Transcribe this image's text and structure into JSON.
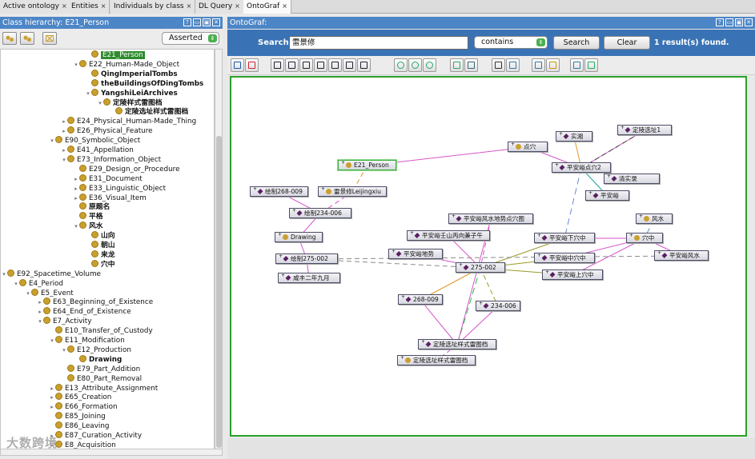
{
  "tabs": [
    {
      "label": "Active ontology",
      "close": "×",
      "active": false
    },
    {
      "label": "Entities",
      "close": "×",
      "active": false
    },
    {
      "label": "Individuals by class",
      "close": "×",
      "active": false
    },
    {
      "label": "DL Query",
      "close": "×",
      "active": false
    },
    {
      "label": "OntoGraf",
      "close": "×",
      "active": true
    }
  ],
  "left": {
    "title": "Class hierarchy: E21_Person",
    "header_buttons": [
      "?",
      "▭",
      "▣",
      "✕"
    ],
    "asserted": "Asserted",
    "tree": [
      {
        "label": "E21_Person",
        "indent": 140,
        "twisty": "",
        "bold": false,
        "sel": true
      },
      {
        "label": "E22_Human-Made_Object",
        "indent": 125,
        "twisty": "▾",
        "bold": false
      },
      {
        "label": "QingImperialTombs",
        "indent": 140,
        "twisty": "",
        "bold": true
      },
      {
        "label": "theBuildingsOfDingTombs",
        "indent": 140,
        "twisty": "",
        "bold": true
      },
      {
        "label": "YangshiLeiArchives",
        "indent": 140,
        "twisty": "▾",
        "bold": true
      },
      {
        "label": "定陵样式雷图档",
        "indent": 155,
        "twisty": "▾",
        "bold": true
      },
      {
        "label": "定陵选址样式雷图档",
        "indent": 170,
        "twisty": "",
        "bold": true
      },
      {
        "label": "E24_Physical_Human-Made_Thing",
        "indent": 110,
        "twisty": "▸",
        "bold": false
      },
      {
        "label": "E26_Physical_Feature",
        "indent": 110,
        "twisty": "▸",
        "bold": false
      },
      {
        "label": "E90_Symbolic_Object",
        "indent": 95,
        "twisty": "▾",
        "bold": false
      },
      {
        "label": "E41_Appellation",
        "indent": 110,
        "twisty": "▸",
        "bold": false
      },
      {
        "label": "E73_Information_Object",
        "indent": 110,
        "twisty": "▾",
        "bold": false
      },
      {
        "label": "E29_Design_or_Procedure",
        "indent": 125,
        "twisty": "",
        "bold": false
      },
      {
        "label": "E31_Document",
        "indent": 125,
        "twisty": "▸",
        "bold": false
      },
      {
        "label": "E33_Linguistic_Object",
        "indent": 125,
        "twisty": "▸",
        "bold": false
      },
      {
        "label": "E36_Visual_Item",
        "indent": 125,
        "twisty": "▸",
        "bold": false
      },
      {
        "label": "原题名",
        "indent": 125,
        "twisty": "",
        "bold": true
      },
      {
        "label": "平格",
        "indent": 125,
        "twisty": "",
        "bold": true
      },
      {
        "label": "风水",
        "indent": 125,
        "twisty": "▾",
        "bold": true
      },
      {
        "label": "山向",
        "indent": 140,
        "twisty": "",
        "bold": true
      },
      {
        "label": "朝山",
        "indent": 140,
        "twisty": "",
        "bold": true
      },
      {
        "label": "来龙",
        "indent": 140,
        "twisty": "",
        "bold": true
      },
      {
        "label": "穴中",
        "indent": 140,
        "twisty": "",
        "bold": true
      },
      {
        "label": "E92_Spacetime_Volume",
        "indent": 35,
        "twisty": "▾",
        "bold": false
      },
      {
        "label": "E4_Period",
        "indent": 50,
        "twisty": "▾",
        "bold": false
      },
      {
        "label": "E5_Event",
        "indent": 65,
        "twisty": "▾",
        "bold": false
      },
      {
        "label": "E63_Beginning_of_Existence",
        "indent": 80,
        "twisty": "▸",
        "bold": false
      },
      {
        "label": "E64_End_of_Existence",
        "indent": 80,
        "twisty": "▸",
        "bold": false
      },
      {
        "label": "E7_Activity",
        "indent": 80,
        "twisty": "▾",
        "bold": false
      },
      {
        "label": "E10_Transfer_of_Custody",
        "indent": 95,
        "twisty": "",
        "bold": false
      },
      {
        "label": "E11_Modification",
        "indent": 95,
        "twisty": "▾",
        "bold": false
      },
      {
        "label": "E12_Production",
        "indent": 110,
        "twisty": "▾",
        "bold": false
      },
      {
        "label": "Drawing",
        "indent": 125,
        "twisty": "",
        "bold": true
      },
      {
        "label": "E79_Part_Addition",
        "indent": 110,
        "twisty": "",
        "bold": false
      },
      {
        "label": "E80_Part_Removal",
        "indent": 110,
        "twisty": "",
        "bold": false
      },
      {
        "label": "E13_Attribute_Assignment",
        "indent": 95,
        "twisty": "▸",
        "bold": false
      },
      {
        "label": "E65_Creation",
        "indent": 95,
        "twisty": "▸",
        "bold": false
      },
      {
        "label": "E66_Formation",
        "indent": 95,
        "twisty": "▸",
        "bold": false
      },
      {
        "label": "E85_Joining",
        "indent": 95,
        "twisty": "",
        "bold": false
      },
      {
        "label": "E86_Leaving",
        "indent": 95,
        "twisty": "",
        "bold": false
      },
      {
        "label": "E87_Curation_Activity",
        "indent": 95,
        "twisty": "▸",
        "bold": false
      },
      {
        "label": "E8_Acquisition",
        "indent": 95,
        "twisty": "▸",
        "bold": false
      }
    ]
  },
  "right": {
    "title": "OntoGraf:",
    "header_buttons": [
      "?",
      "▭",
      "▣",
      "✕"
    ],
    "search_label": "Search:",
    "search_value": "雷景修",
    "match_mode": "contains",
    "search_button": "Search",
    "clear_button": "Clear",
    "result_text": "1 result(s) found."
  },
  "watermark": "大数跨境",
  "colors": {
    "header_blue": "#4d86c6",
    "search_bar": "#3a73b5",
    "graph_border": "#2aa02a",
    "selected_tree": "#2e8b2e",
    "class_dot": "#c9a02e",
    "individual_diamond": "#5a2060"
  },
  "nodes": [
    {
      "id": "E21_Person",
      "label": "E21_Person",
      "kind": "class",
      "sel": true,
      "plus": true
    },
    {
      "id": "dianxue",
      "label": "点穴",
      "kind": "class",
      "plus": true
    },
    {
      "id": "shixiang",
      "label": "实湘",
      "kind": "ind",
      "plus": true
    },
    {
      "id": "dingling1",
      "label": "定陵选址1",
      "kind": "ind",
      "plus": true
    },
    {
      "id": "pad2",
      "label": "平安峪点穴2",
      "kind": "ind",
      "plus": true
    },
    {
      "id": "qingshi",
      "label": "清实录",
      "kind": "ind",
      "plus": true
    },
    {
      "id": "pay",
      "label": "平安峪",
      "kind": "ind",
      "plus": true
    },
    {
      "id": "hz268",
      "label": "绘制268-009",
      "kind": "ind",
      "plus": true
    },
    {
      "id": "lei",
      "label": "雷景修Leijingxiu",
      "kind": "class",
      "plus": true
    },
    {
      "id": "hz234",
      "label": "绘制234-006",
      "kind": "ind",
      "plus": true
    },
    {
      "id": "fengshuitu",
      "label": "平安峪风水地势点穴图",
      "kind": "ind",
      "plus": true
    },
    {
      "id": "fengshui",
      "label": "风水",
      "kind": "class",
      "plus": true
    },
    {
      "id": "drawing",
      "label": "Drawing",
      "kind": "class",
      "plus": true
    },
    {
      "id": "renshan",
      "label": "平安峪壬山丙向兼子午",
      "kind": "ind",
      "plus": true
    },
    {
      "id": "xiaxue",
      "label": "平安峪下穴中",
      "kind": "ind",
      "plus": true
    },
    {
      "id": "xuezhong",
      "label": "穴中",
      "kind": "class",
      "plus": true
    },
    {
      "id": "dishi",
      "label": "平安峪地势",
      "kind": "ind",
      "plus": true
    },
    {
      "id": "hz275",
      "label": "绘制275-002",
      "kind": "ind",
      "plus": true
    },
    {
      "id": "n275",
      "label": "275-002",
      "kind": "ind",
      "plus": true
    },
    {
      "id": "zhongxue",
      "label": "平安峪中穴中",
      "kind": "ind",
      "plus": true
    },
    {
      "id": "pafs",
      "label": "平安峪风水",
      "kind": "ind",
      "plus": true
    },
    {
      "id": "shangxue",
      "label": "平安峪上穴中",
      "kind": "ind",
      "plus": true
    },
    {
      "id": "xianfeng",
      "label": "咸丰二年九月",
      "kind": "ind",
      "plus": true
    },
    {
      "id": "n268",
      "label": "268-009",
      "kind": "ind",
      "plus": true
    },
    {
      "id": "n234",
      "label": "234-006",
      "kind": "ind",
      "plus": true
    },
    {
      "id": "dlxz_a",
      "label": "定陵选址样式雷图档",
      "kind": "ind",
      "plus": true
    },
    {
      "id": "dlxz_b",
      "label": "定陵选址样式雷图档",
      "kind": "class",
      "plus": true
    }
  ],
  "edges": [
    {
      "from": "E21_Person",
      "to": "dianxue",
      "style": "pink"
    },
    {
      "from": "dianxue",
      "to": "pad2",
      "style": "pink"
    },
    {
      "from": "pad2",
      "to": "shixiang",
      "style": "orange"
    },
    {
      "from": "dingling1",
      "to": "pad2",
      "style": "pinkdash"
    },
    {
      "from": "pad2",
      "to": "dingling1",
      "style": "blackdash"
    },
    {
      "from": "pad2",
      "to": "qingshi",
      "style": "pink"
    },
    {
      "from": "pad2",
      "to": "pay",
      "style": "teal"
    },
    {
      "from": "pad2",
      "to": "xiaxue",
      "style": "bluedash"
    },
    {
      "from": "E21_Person",
      "to": "lei",
      "style": "orangedash"
    },
    {
      "from": "lei",
      "to": "hz234",
      "style": "pinkdash"
    },
    {
      "from": "hz268",
      "to": "hz234",
      "style": "pink"
    },
    {
      "from": "hz234",
      "to": "drawing",
      "style": "pink"
    },
    {
      "from": "drawing",
      "to": "hz275",
      "style": "pink"
    },
    {
      "from": "hz275",
      "to": "xianfeng",
      "style": "pink"
    },
    {
      "from": "hz275",
      "to": "n275",
      "style": "graydash"
    },
    {
      "from": "fengshuitu",
      "to": "n275",
      "style": "pinkdash"
    },
    {
      "from": "renshan",
      "to": "n275",
      "style": "pink"
    },
    {
      "from": "dishi",
      "to": "n275",
      "style": "pink"
    },
    {
      "from": "n275",
      "to": "xiaxue",
      "style": "olive"
    },
    {
      "from": "n275",
      "to": "zhongxue",
      "style": "olive"
    },
    {
      "from": "n275",
      "to": "shangxue",
      "style": "olive"
    },
    {
      "from": "xiaxue",
      "to": "xuezhong",
      "style": "pink"
    },
    {
      "from": "zhongxue",
      "to": "xuezhong",
      "style": "pink"
    },
    {
      "from": "shangxue",
      "to": "xuezhong",
      "style": "pink"
    },
    {
      "from": "fengshui",
      "to": "xuezhong",
      "style": "bluedash"
    },
    {
      "from": "xuezhong",
      "to": "pafs",
      "style": "pink"
    },
    {
      "from": "hz275",
      "to": "pafs",
      "style": "graydash"
    },
    {
      "from": "n275",
      "to": "n268",
      "style": "orange"
    },
    {
      "from": "n275",
      "to": "n234",
      "style": "olivedash"
    },
    {
      "from": "n268",
      "to": "dlxz_a",
      "style": "pink"
    },
    {
      "from": "n234",
      "to": "dlxz_a",
      "style": "pink"
    },
    {
      "from": "n275",
      "to": "dlxz_a",
      "style": "greendash"
    },
    {
      "from": "dlxz_a",
      "to": "dlxz_b",
      "style": "pinkdash"
    },
    {
      "from": "fengshuitu",
      "to": "dlxz_a",
      "style": "pink"
    }
  ]
}
